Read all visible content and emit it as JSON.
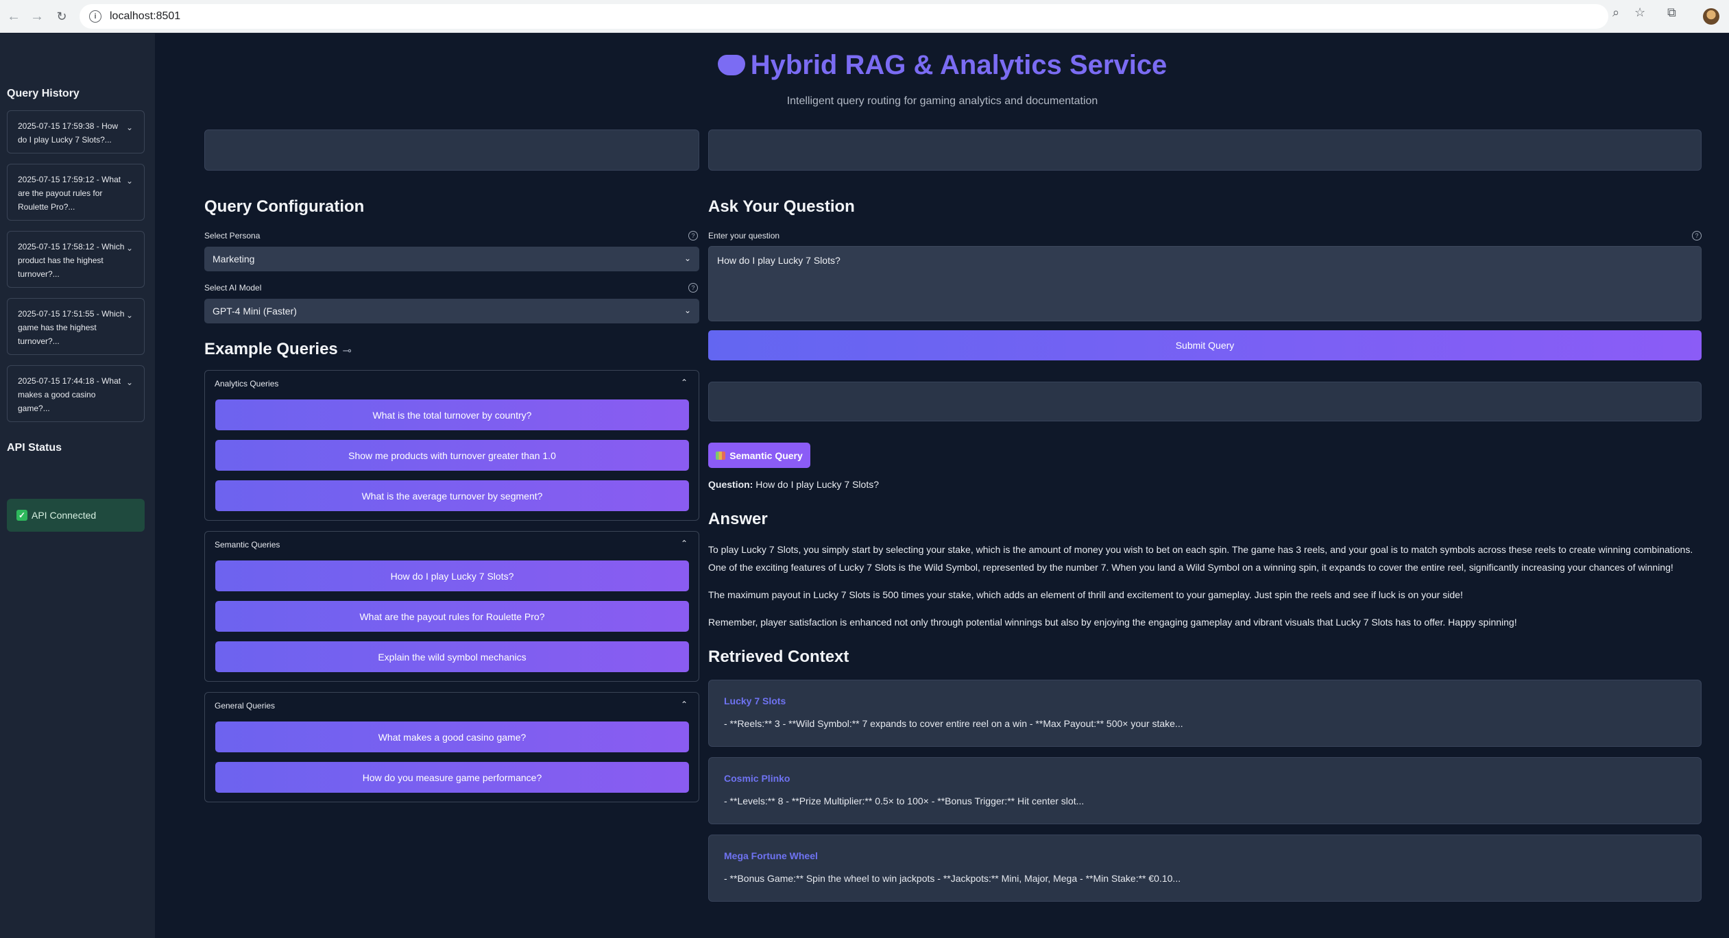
{
  "browser": {
    "url": "localhost:8501"
  },
  "sidebar": {
    "history_title": "Query History",
    "history": [
      "2025-07-15 17:59:38 - How do I play Lucky 7 Slots?...",
      "2025-07-15 17:59:12 - What are the payout rules for Roulette Pro?...",
      "2025-07-15 17:58:12 - Which product has the highest turnover?...",
      "2025-07-15 17:51:55 - Which game has the highest turnover?...",
      "2025-07-15 17:44:18 - What makes a good casino game?..."
    ],
    "api_title": "API Status",
    "api_status": "API Connected"
  },
  "header": {
    "title": "Hybrid RAG & Analytics Service",
    "subtitle": "Intelligent query routing for gaming analytics and documentation"
  },
  "config": {
    "title": "Query Configuration",
    "persona_label": "Select Persona",
    "persona_value": "Marketing",
    "model_label": "Select AI Model",
    "model_value": "GPT-4 Mini (Faster)"
  },
  "examples": {
    "title": "Example Queries",
    "groups": [
      {
        "title": "Analytics Queries",
        "items": [
          "What is the total turnover by country?",
          "Show me products with turnover greater than 1.0",
          "What is the average turnover by segment?"
        ]
      },
      {
        "title": "Semantic Queries",
        "items": [
          "How do I play Lucky 7 Slots?",
          "What are the payout rules for Roulette Pro?",
          "Explain the wild symbol mechanics"
        ]
      },
      {
        "title": "General Queries",
        "items": [
          "What makes a good casino game?",
          "How do you measure game performance?"
        ]
      }
    ]
  },
  "ask": {
    "title": "Ask Your Question",
    "input_label": "Enter your question",
    "input_value": "How do I play Lucky 7 Slots?",
    "submit_label": "Submit Query"
  },
  "result": {
    "badge": "Semantic Query",
    "question_label": "Question:",
    "question_value": "How do I play Lucky 7 Slots?",
    "answer_title": "Answer",
    "answer_paragraphs": [
      "To play Lucky 7 Slots, you simply start by selecting your stake, which is the amount of money you wish to bet on each spin. The game has 3 reels, and your goal is to match symbols across these reels to create winning combinations.",
      "One of the exciting features of Lucky 7 Slots is the Wild Symbol, represented by the number 7. When you land a Wild Symbol on a winning spin, it expands to cover the entire reel, significantly increasing your chances of winning!",
      "The maximum payout in Lucky 7 Slots is 500 times your stake, which adds an element of thrill and excitement to your gameplay. Just spin the reels and see if luck is on your side!",
      "Remember, player satisfaction is enhanced not only through potential winnings but also by enjoying the engaging gameplay and vibrant visuals that Lucky 7 Slots has to offer. Happy spinning!"
    ],
    "context_title": "Retrieved Context",
    "contexts": [
      {
        "title": "Lucky 7 Slots",
        "text": "- **Reels:** 3 - **Wild Symbol:** 7 expands to cover entire reel on a win - **Max Payout:** 500× your stake..."
      },
      {
        "title": "Cosmic Plinko",
        "text": "- **Levels:** 8 - **Prize Multiplier:** 0.5× to 100× - **Bonus Trigger:** Hit center slot..."
      },
      {
        "title": "Mega Fortune Wheel",
        "text": "- **Bonus Game:** Spin the wheel to win jackpots - **Jackpots:** Mini, Major, Mega - **Min Stake:** €0.10..."
      }
    ]
  }
}
